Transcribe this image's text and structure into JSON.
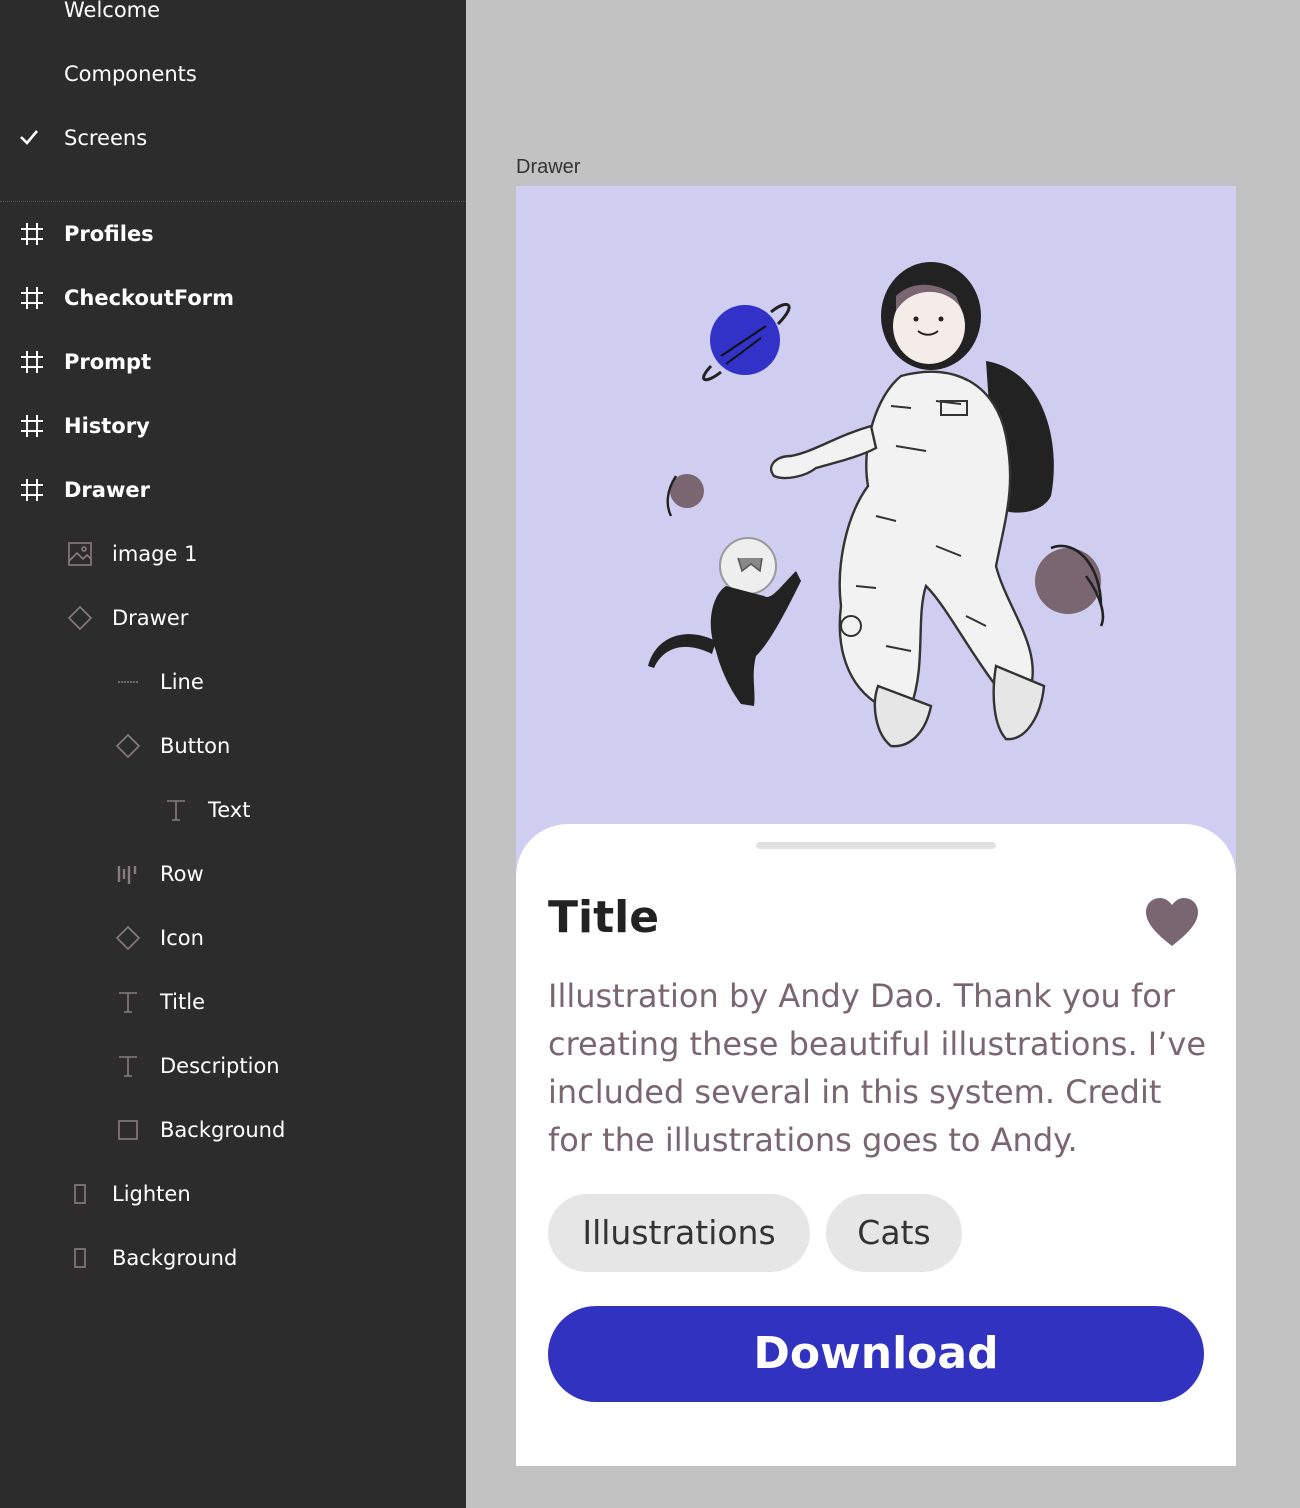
{
  "sidebar": {
    "top_items": [
      {
        "label": "Welcome"
      },
      {
        "label": "Components"
      },
      {
        "label": "Screens",
        "checked": true
      }
    ],
    "frames": [
      {
        "label": "Profiles"
      },
      {
        "label": "CheckoutForm"
      },
      {
        "label": "Prompt"
      },
      {
        "label": "History"
      },
      {
        "label": "Drawer"
      }
    ],
    "layers": [
      {
        "label": "image 1",
        "icon": "image-icon"
      },
      {
        "label": "Drawer",
        "icon": "component-icon"
      },
      {
        "label": "Line",
        "icon": "line-icon"
      },
      {
        "label": "Button",
        "icon": "component-icon"
      },
      {
        "label": "Text",
        "icon": "text-icon"
      },
      {
        "label": "Row",
        "icon": "row-layout-icon"
      },
      {
        "label": "Icon",
        "icon": "component-icon"
      },
      {
        "label": "Title",
        "icon": "text-icon"
      },
      {
        "label": "Description",
        "icon": "text-icon"
      },
      {
        "label": "Background",
        "icon": "rectangle-icon"
      },
      {
        "label": "Lighten",
        "icon": "frame-icon"
      },
      {
        "label": "Background",
        "icon": "frame-icon"
      }
    ]
  },
  "canvas": {
    "frame_label": "Drawer",
    "card": {
      "title": "Title",
      "description": "Illustration by Andy Dao. Thank you for creating these beautiful illustrations. I’ve included several in this system. Credit for the illustrations goes to Andy.",
      "tags": [
        "Illustrations",
        "Cats"
      ],
      "button_label": "Download"
    }
  },
  "colors": {
    "sidebar_bg": "#2c2c2c",
    "canvas_bg": "#c2c2c2",
    "hero_bg": "#cfcdf0",
    "accent": "#3232c0",
    "heart": "#7a6670",
    "description_text": "#7a6670"
  }
}
